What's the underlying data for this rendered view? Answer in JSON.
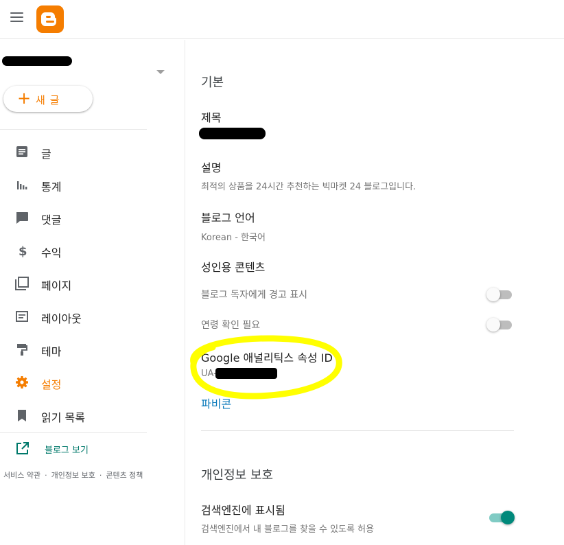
{
  "topbar": {
    "menu_icon": "hamburger-menu-icon",
    "logo_icon": "blogger-logo-icon",
    "brand_color": "#f57d00"
  },
  "sidebar": {
    "new_post_label": "새 글",
    "items": [
      {
        "label": "글",
        "icon": "posts-icon",
        "active": false
      },
      {
        "label": "통계",
        "icon": "stats-icon",
        "active": false
      },
      {
        "label": "댓글",
        "icon": "comments-icon",
        "active": false
      },
      {
        "label": "수익",
        "icon": "dollar-icon",
        "active": false
      },
      {
        "label": "페이지",
        "icon": "pages-icon",
        "active": false
      },
      {
        "label": "레이아웃",
        "icon": "layout-icon",
        "active": false
      },
      {
        "label": "테마",
        "icon": "theme-paint-roller-icon",
        "active": false
      },
      {
        "label": "설정",
        "icon": "settings-gear-icon",
        "active": true
      },
      {
        "label": "읽기 목록",
        "icon": "bookmark-icon",
        "active": false
      }
    ],
    "view_blog_label": "블로그 보기",
    "footer": {
      "terms": "서비스 약관",
      "privacy": "개인정보 보호",
      "content_policy": "콘텐츠 정책",
      "separator": "·"
    }
  },
  "main": {
    "basic_section_title": "기본",
    "title_label": "제목",
    "description_label": "설명",
    "description_value": "최적의 상품을 24시간 추천하는 빅마켓 24 블로그입니다.",
    "language_label": "블로그 언어",
    "language_value": "Korean - 한국어",
    "adult_label": "성인용 콘텐츠",
    "adult_warning_label": "블로그 독자에게 경고 표시",
    "adult_warning_on": false,
    "age_check_label": "연령 확인 필요",
    "age_check_on": false,
    "analytics_label": "Google 애널리틱스 속성 ID",
    "analytics_prefix": "UA-",
    "favicon_label": "파비콘",
    "privacy_section_title": "개인정보 보호",
    "search_visible_label": "검색엔진에 표시됨",
    "search_visible_desc": "검색엔진에서 내 블로그를 찾을 수 있도록 허용",
    "search_visible_on": true
  },
  "colors": {
    "accent": "#f57d00",
    "link": "#0b7abb",
    "toggle_on": "#00897b",
    "highlight": "#ffff00"
  }
}
